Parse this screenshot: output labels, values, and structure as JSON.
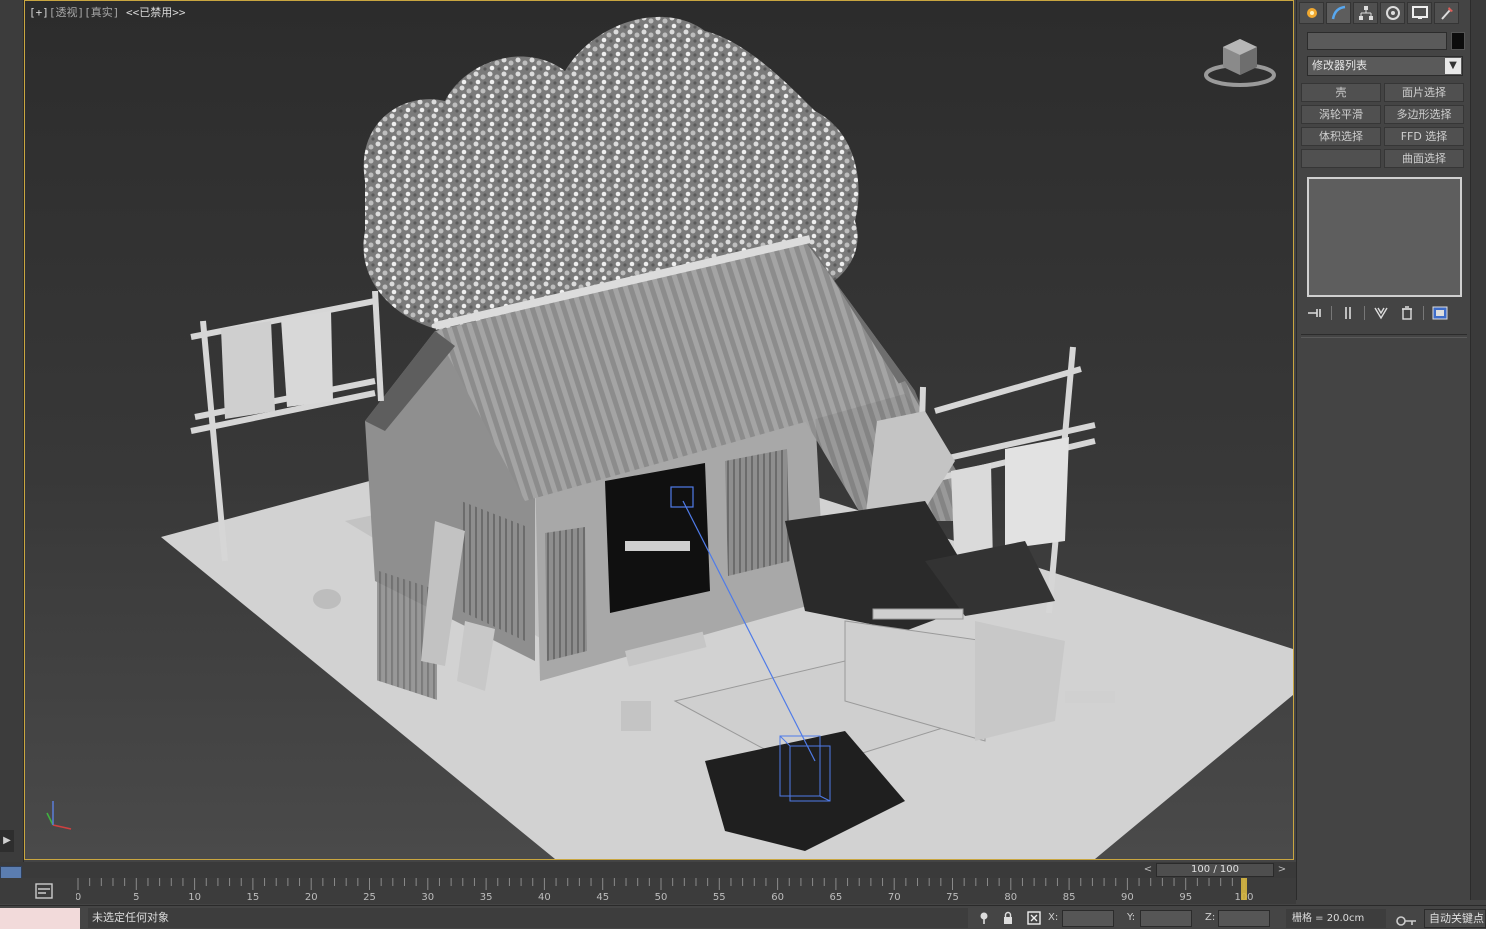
{
  "viewport": {
    "label_plus": "[+]",
    "label_view": "[透视]",
    "label_shading": "[真实]",
    "label_disabled": "<<已禁用>>"
  },
  "command_panel": {
    "tabs": [
      "create-icon",
      "modify-icon",
      "hierarchy-icon",
      "motion-icon",
      "display-icon",
      "utilities-icon"
    ],
    "name_value": "",
    "color_swatch": "#0c0c0c",
    "modifier_list": "修改器列表",
    "modifier_buttons": [
      "壳",
      "面片选择",
      "涡轮平滑",
      "多边形选择",
      "体积选择",
      "FFD 选择",
      "",
      "曲面选择"
    ]
  },
  "timeline": {
    "frame_display": "100 / 100",
    "prev": "<",
    "next": ">",
    "ticks": [
      "0",
      "5",
      "10",
      "15",
      "20",
      "25",
      "30",
      "35",
      "40",
      "45",
      "50",
      "55",
      "60",
      "65",
      "70",
      "75",
      "80",
      "85",
      "90",
      "95",
      "100"
    ],
    "current_frame": 100,
    "total_frames": 100
  },
  "status_bar": {
    "message": "未选定任何对象",
    "x_label": "X:",
    "y_label": "Y:",
    "z_label": "Z:",
    "x_value": "",
    "y_value": "",
    "z_value": "",
    "grid": "栅格 = 20.0cm",
    "auto_key": "自动关键点"
  },
  "colors": {
    "viewport_border": "#c9a640",
    "timeline_marker": "#d6b640",
    "selection_blue": "#4f7be8"
  }
}
